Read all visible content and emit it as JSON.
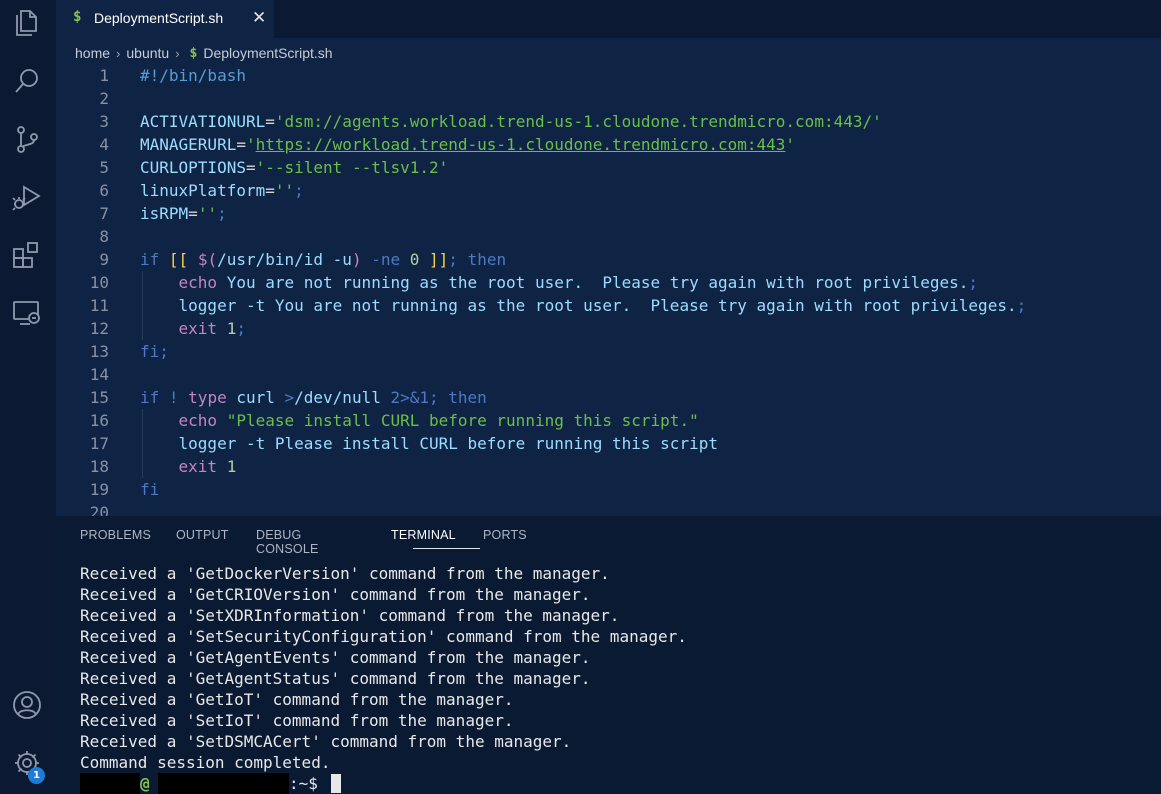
{
  "activity_bar": {
    "icons": [
      "files-icon",
      "search-icon",
      "source-control-icon",
      "run-debug-icon",
      "extensions-icon",
      "remote-explorer-icon",
      "account-icon",
      "gear-icon"
    ],
    "settings_badge": "1"
  },
  "tab": {
    "file_icon": "$",
    "label": "DeploymentScript.sh",
    "close": "✕"
  },
  "breadcrumb": {
    "items": [
      "home",
      "ubuntu"
    ],
    "file_icon": "$",
    "file": "DeploymentScript.sh"
  },
  "editor": {
    "line_numbers": [
      "1",
      "2",
      "3",
      "4",
      "5",
      "6",
      "7",
      "8",
      "9",
      "10",
      "11",
      "12",
      "13",
      "14",
      "15",
      "16",
      "17",
      "18",
      "19",
      "20"
    ]
  },
  "panel": {
    "tabs": [
      "PROBLEMS",
      "OUTPUT",
      "DEBUG CONSOLE",
      "TERMINAL",
      "PORTS"
    ],
    "active_tab": "TERMINAL",
    "terminal_lines": [
      "Received a 'GetDockerVersion' command from the manager.",
      "Received a 'GetCRIOVersion' command from the manager.",
      "Received a 'SetXDRInformation' command from the manager.",
      "Received a 'SetSecurityConfiguration' command from the manager.",
      "Received a 'GetAgentEvents' command from the manager.",
      "Received a 'GetAgentStatus' command from the manager.",
      "Received a 'GetIoT' command from the manager.",
      "Received a 'SetIoT' command from the manager.",
      "Received a 'SetDSMCACert' command from the manager.",
      "Command session completed."
    ],
    "prompt_at": "@",
    "prompt_tail": ":~$ "
  }
}
